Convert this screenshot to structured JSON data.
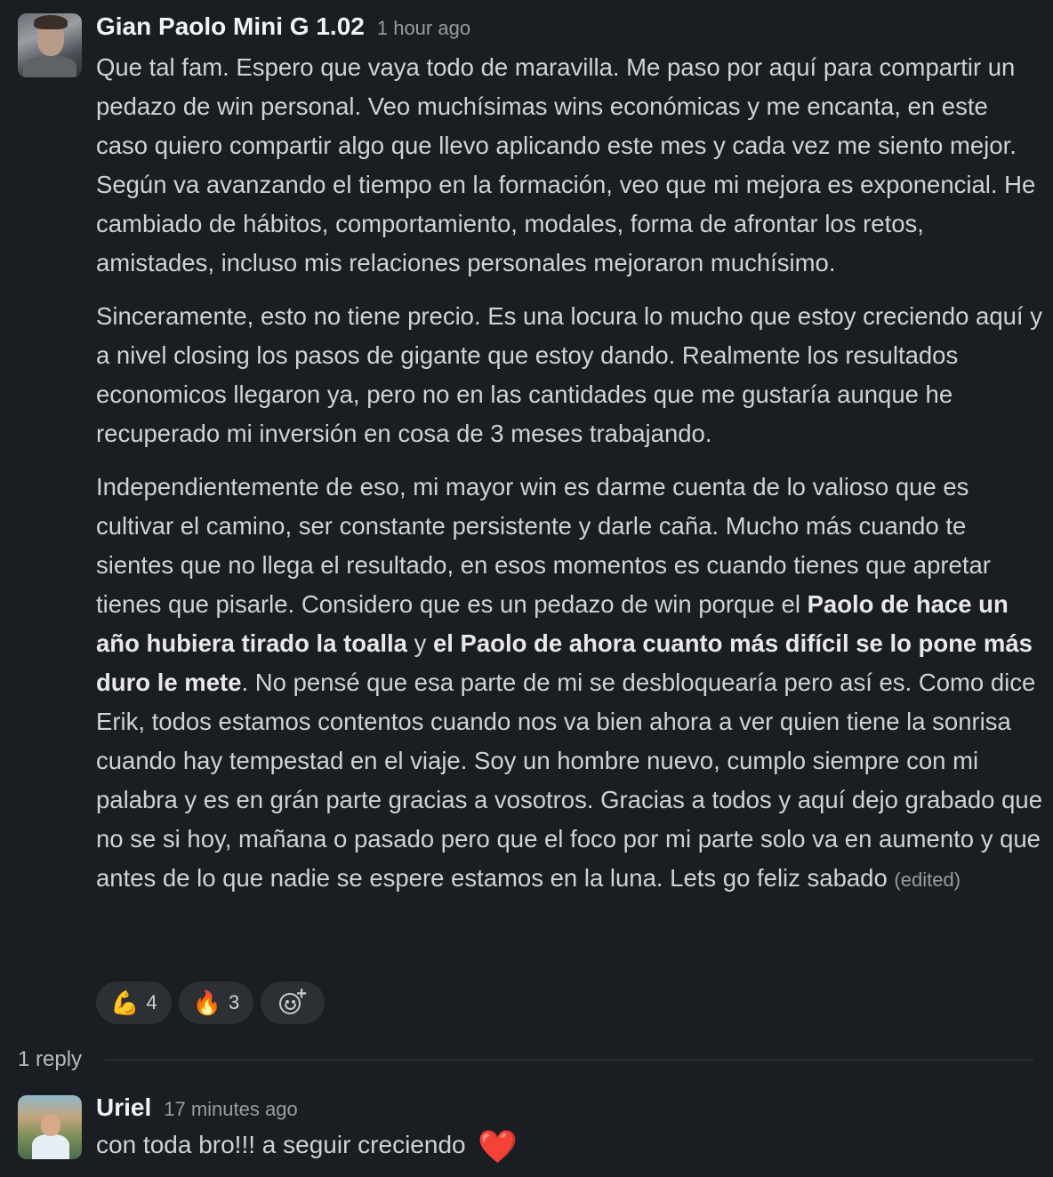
{
  "post": {
    "author": "Gian Paolo Mini G 1.02",
    "time": "1 hour ago",
    "para1": "Que tal fam. Espero que vaya todo de maravilla. Me paso por aquí para compartir un pedazo de win personal. Veo muchísimas wins económicas y me encanta, en este caso quiero compartir algo que llevo aplicando este mes y cada vez me siento mejor. Según va avanzando el tiempo en la formación, veo que mi mejora es exponencial. He cambiado de hábitos, comportamiento, modales, forma de afrontar los retos, amistades, incluso mis relaciones personales mejoraron muchísimo.",
    "para2": "Sinceramente, esto no tiene precio. Es una locura lo mucho que estoy creciendo aquí y a nivel closing los pasos de gigante que estoy dando. Realmente los resultados economicos llegaron ya, pero no en las cantidades que me gustaría aunque he recuperado mi inversión en cosa de 3 meses trabajando.",
    "para3_a": "Independientemente de eso, mi mayor win es darme cuenta de lo valioso que es cultivar el camino, ser constante persistente y darle caña. Mucho más cuando te sientes que no llega el resultado, en esos momentos es cuando tienes que apretar tienes que pisarle. Considero que es un pedazo de win porque el ",
    "para3_bold1": "Paolo de hace un año hubiera tirado la toalla",
    "para3_b": " y ",
    "para3_bold2": "el Paolo de ahora cuanto más difícil se lo pone más duro le mete",
    "para3_c": ". No pensé que esa parte de mi se desbloquearía pero así es. Como dice Erik, todos estamos contentos cuando nos va bien ahora a ver quien tiene la sonrisa cuando hay tempestad en el viaje. Soy un hombre nuevo, cumplo siempre con mi palabra y es en grán parte gracias a vosotros. Gracias a todos y aquí dejo grabado que no se si hoy, mañana o pasado pero que el foco por mi parte solo va en aumento y que antes de lo que nadie se espere estamos en la luna. Lets go feliz sabado",
    "edited": "(edited)",
    "reactions": [
      {
        "emoji": "💪",
        "count": "4",
        "icon": "flexed-biceps"
      },
      {
        "emoji": "🔥",
        "count": "3",
        "icon": "fire"
      }
    ]
  },
  "thread": {
    "replies_label": "1 reply"
  },
  "reply": {
    "author": "Uriel",
    "time": "17 minutes ago",
    "text": "con toda bro!!! a seguir creciendo",
    "emoji": "❤️"
  }
}
